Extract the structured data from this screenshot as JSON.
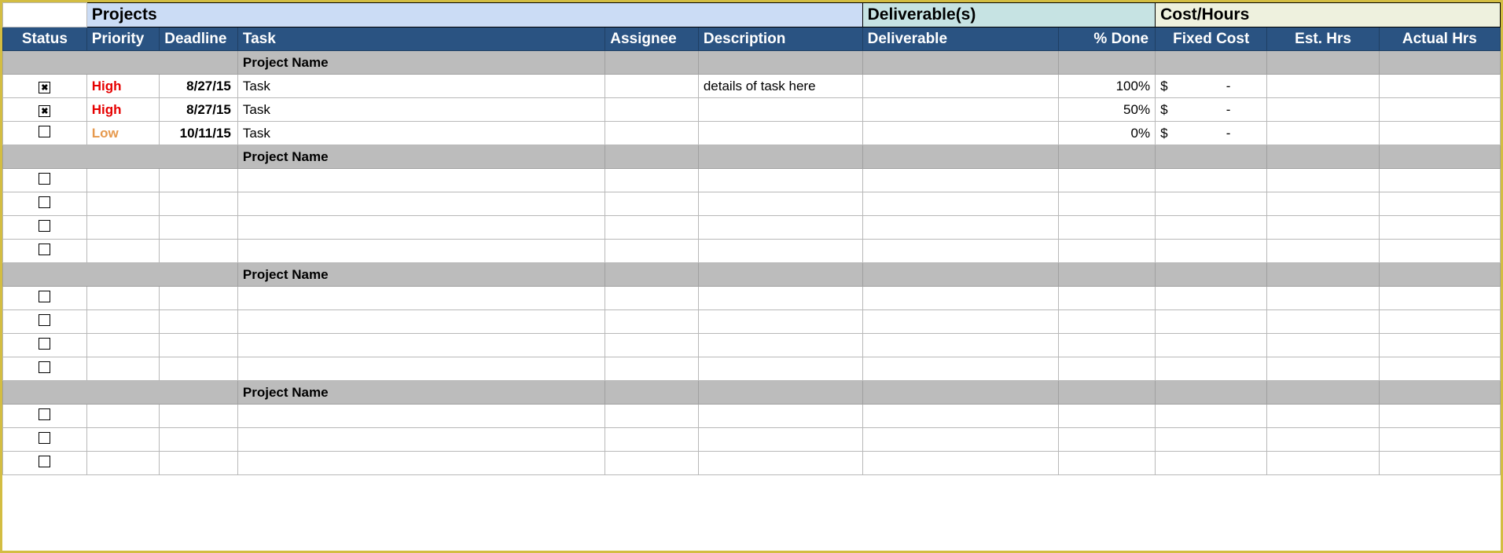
{
  "sections": {
    "projects": "Projects",
    "deliverables": "Deliverable(s)",
    "cost": "Cost/Hours"
  },
  "columns": {
    "status": "Status",
    "priority": "Priority",
    "deadline": "Deadline",
    "task": "Task",
    "assignee": "Assignee",
    "description": "Description",
    "deliverable": "Deliverable",
    "pct_done": "% Done",
    "fixed_cost": "Fixed Cost",
    "est_hrs": "Est. Hrs",
    "actual_hrs": "Actual Hrs"
  },
  "groups": [
    {
      "name": "Project Name",
      "rows": [
        {
          "status_checked": true,
          "priority": "High",
          "priority_class": "high",
          "deadline": "8/27/15",
          "task": "Task",
          "assignee": "",
          "description": "details of task here",
          "deliverable": "",
          "pct_done": "100%",
          "fixed_cost": {
            "sym": "$",
            "val": "-"
          },
          "est_hrs": "",
          "actual_hrs": ""
        },
        {
          "status_checked": true,
          "priority": "High",
          "priority_class": "high",
          "deadline": "8/27/15",
          "task": "Task",
          "assignee": "",
          "description": "",
          "deliverable": "",
          "pct_done": "50%",
          "fixed_cost": {
            "sym": "$",
            "val": "-"
          },
          "est_hrs": "",
          "actual_hrs": ""
        },
        {
          "status_checked": false,
          "priority": "Low",
          "priority_class": "low",
          "deadline": "10/11/15",
          "task": "Task",
          "assignee": "",
          "description": "",
          "deliverable": "",
          "pct_done": "0%",
          "fixed_cost": {
            "sym": "$",
            "val": "-"
          },
          "est_hrs": "",
          "actual_hrs": ""
        }
      ]
    },
    {
      "name": "Project Name",
      "rows": [
        {
          "status_checked": false
        },
        {
          "status_checked": false
        },
        {
          "status_checked": false
        },
        {
          "status_checked": false
        }
      ]
    },
    {
      "name": "Project Name",
      "rows": [
        {
          "status_checked": false
        },
        {
          "status_checked": false
        },
        {
          "status_checked": false
        },
        {
          "status_checked": false
        }
      ]
    },
    {
      "name": "Project Name",
      "rows": [
        {
          "status_checked": false
        },
        {
          "status_checked": false
        },
        {
          "status_checked": false
        }
      ]
    }
  ]
}
